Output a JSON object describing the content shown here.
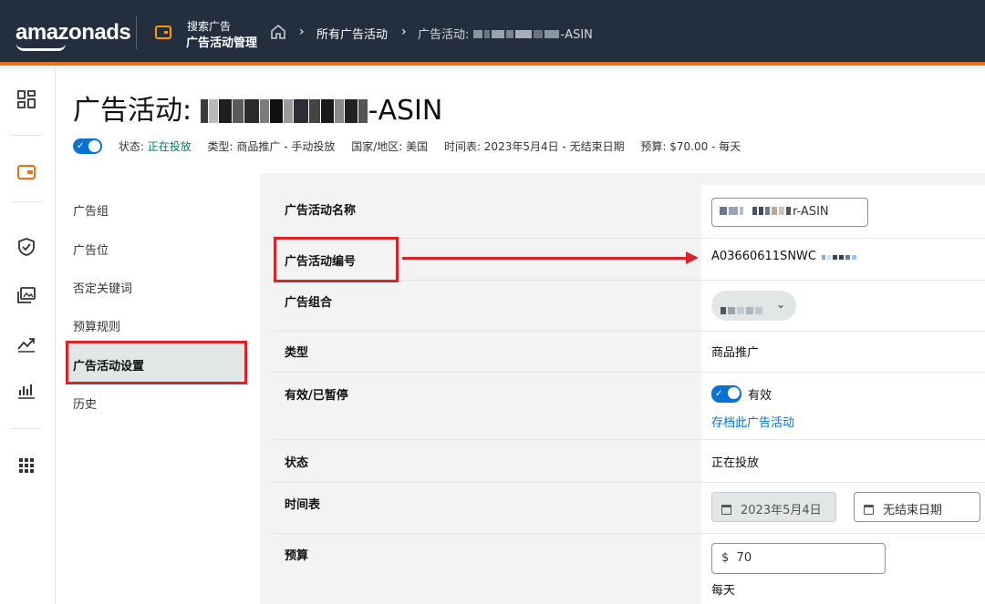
{
  "header": {
    "logo": "amazonads",
    "product_small": "搜索广告",
    "product_big": "广告活动管理",
    "breadcrumbs": [
      "所有广告活动",
      "广告活动: ",
      "-ASIN"
    ]
  },
  "title": {
    "prefix": "广告活动: ",
    "suffix": "-ASIN"
  },
  "meta": {
    "status_label": "状态:",
    "status_value": "正在投放",
    "type": "类型: 商品推广 - 手动投放",
    "country": "国家/地区: 美国",
    "schedule": "时间表: 2023年5月4日 - 无结束日期",
    "budget": "预算: $70.00 - 每天"
  },
  "nav": {
    "items": [
      "广告组",
      "广告位",
      "否定关键词",
      "预算规则",
      "广告活动设置",
      "历史"
    ],
    "active": "广告活动设置"
  },
  "settings": {
    "name_label": "广告活动名称",
    "name_value_suffix": "r-ASIN",
    "id_label": "广告活动编号",
    "id_value": "A03660611SNWC",
    "adgroup_label": "广告组合",
    "type_label": "类型",
    "type_value": "商品推广",
    "active_label": "有效/已暂停",
    "active_value": "有效",
    "archive_link": "存档此广告活动",
    "status_label": "状态",
    "status_value": "正在投放",
    "schedule_label": "时间表",
    "start_date": "2023年5月4日",
    "end_date": "无结束日期",
    "budget_label": "预算",
    "currency": "$",
    "budget_value": "70",
    "budget_period": "每天"
  },
  "colors": {
    "accent": "#0972d3",
    "brand_orange": "#e8731a",
    "annotation_red": "#d8232a",
    "success_green": "#067d62"
  }
}
